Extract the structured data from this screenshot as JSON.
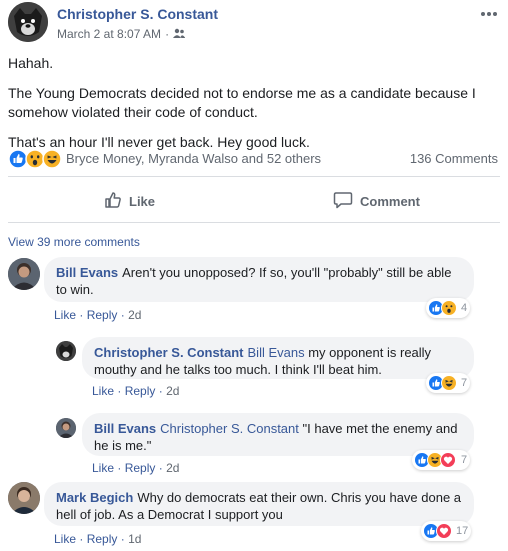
{
  "post": {
    "author": "Christopher S. Constant",
    "timestamp": "March 2 at 8:07 AM",
    "separator": "·",
    "audience_icon": "friends-icon",
    "paragraphs": [
      "Hahah.",
      "The Young Democrats decided not to endorse me as a candidate because I somehow violated their code of conduct.",
      "That's an hour I'll never get back. Hey good luck."
    ],
    "reactions": {
      "icons": [
        "like-reaction-icon",
        "wow-reaction-icon",
        "haha-reaction-icon"
      ],
      "names": "Bryce Money, Myranda Walso and 52 others",
      "comments_count": "136 Comments"
    },
    "actions": {
      "like_label": "Like",
      "comment_label": "Comment"
    }
  },
  "view_more_comments": "View 39 more comments",
  "comments": [
    {
      "author": "Bill Evans",
      "mention": "",
      "text": "Aren't you unopposed? If so, you'll \"probably\" still be able to win.",
      "like": "Like",
      "reply": "Reply",
      "sep": "·",
      "time": "2d",
      "reaction_icons": [
        "like-reaction-icon",
        "wow-reaction-icon"
      ],
      "reaction_count": "4"
    },
    {
      "author": "Christopher S. Constant",
      "mention": "Bill Evans",
      "text": "my opponent is really mouthy and he talks too much. I think I'll beat him.",
      "like": "Like",
      "reply": "Reply",
      "sep": "·",
      "time": "2d",
      "reaction_icons": [
        "like-reaction-icon",
        "haha-reaction-icon"
      ],
      "reaction_count": "7"
    },
    {
      "author": "Bill Evans",
      "mention": "Christopher S. Constant",
      "text": "\"I have met the enemy and he is me.\"",
      "like": "Like",
      "reply": "Reply",
      "sep": "·",
      "time": "2d",
      "reaction_icons": [
        "like-reaction-icon",
        "haha-reaction-icon",
        "love-reaction-icon"
      ],
      "reaction_count": "7"
    },
    {
      "author": "Mark Begich",
      "mention": "",
      "text": "Why do democrats eat their own. Chris you have done a hell of job. As a Democrat I support you",
      "like": "Like",
      "reply": "Reply",
      "sep": "·",
      "time": "1d",
      "reaction_icons": [
        "like-reaction-icon",
        "love-reaction-icon"
      ],
      "reaction_count": "17"
    }
  ],
  "colors": {
    "link_blue": "#385898",
    "like_blue": "#1877f2",
    "wow_yellow": "#f7b125",
    "love_red": "#f33e58",
    "muted_gray": "#606770",
    "bubble_gray": "#f2f3f5"
  }
}
